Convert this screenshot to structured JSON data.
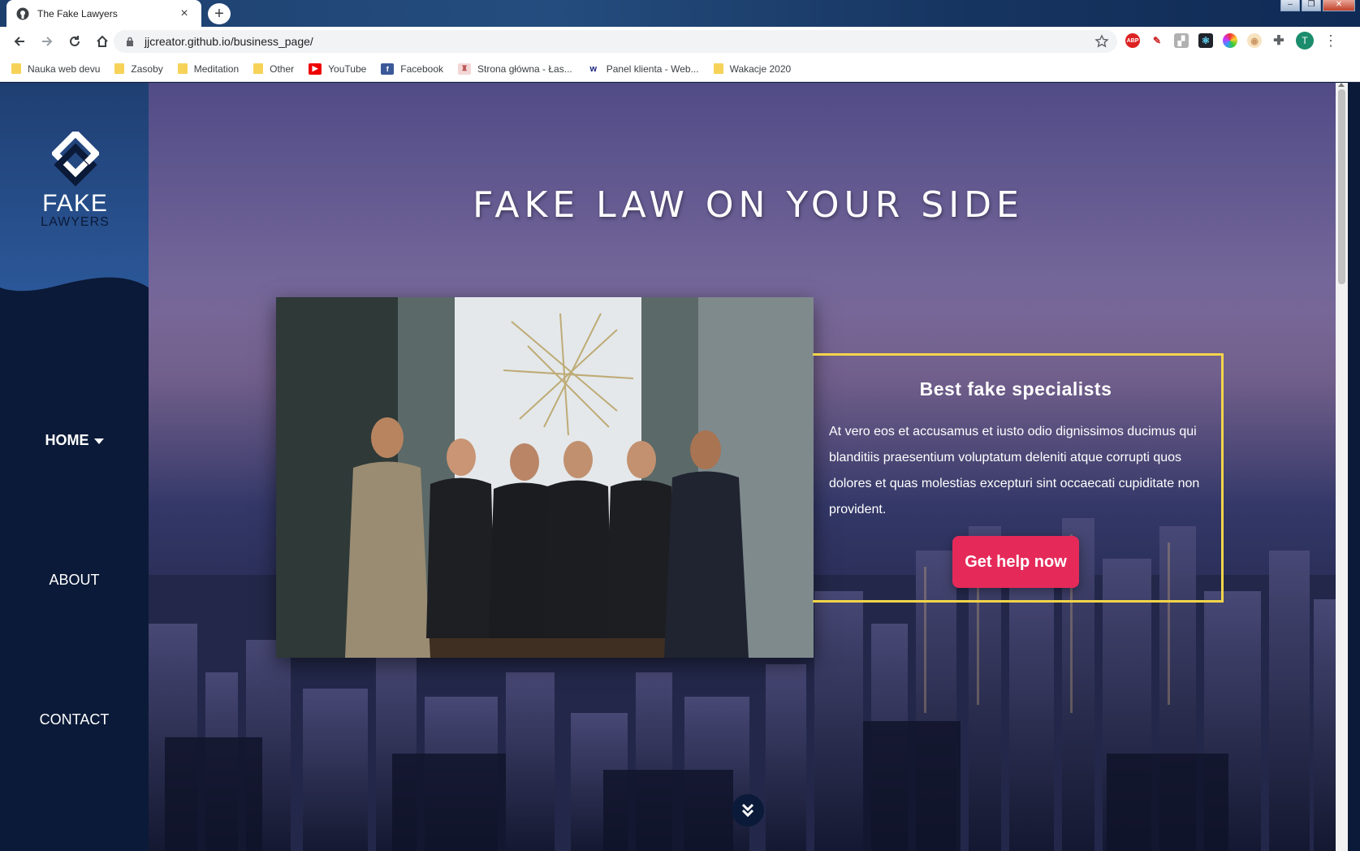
{
  "browser": {
    "tab_title": "The Fake Lawyers",
    "url": "jjcreator.github.io/business_page/",
    "profile_initial": "T",
    "extensions": [
      "ABP",
      "adobe-icon",
      "pdf-icon",
      "react-devtools-icon",
      "colorpicker-icon",
      "onion-icon",
      "puzzle-icon"
    ]
  },
  "bookmarks": [
    {
      "label": "Nauka web devu",
      "icon": "folder-icon"
    },
    {
      "label": "Zasoby",
      "icon": "folder-icon"
    },
    {
      "label": "Meditation",
      "icon": "folder-icon"
    },
    {
      "label": "Other",
      "icon": "folder-icon"
    },
    {
      "label": "YouTube",
      "icon": "youtube-icon"
    },
    {
      "label": "Facebook",
      "icon": "facebook-icon"
    },
    {
      "label": "Strona główna - Łas...",
      "icon": "castle-icon"
    },
    {
      "label": "Panel klienta - Web...",
      "icon": "webhost-icon"
    },
    {
      "label": "Wakacje 2020",
      "icon": "folder-icon"
    }
  ],
  "sidebar": {
    "brand_line1": "FAKE",
    "brand_line2": "LAWYERS",
    "nav": [
      {
        "label": "HOME",
        "active": true
      },
      {
        "label": "ABOUT",
        "active": false
      },
      {
        "label": "CONTACT",
        "active": false
      }
    ]
  },
  "hero": {
    "title": "FAKE LAW ON YOUR SIDE",
    "info_title": "Best fake specialists",
    "info_text": "At vero eos et accusamus et iusto odio dignissimos ducimus qui blanditiis praesentium voluptatum deleniti atque corrupti quos dolores et quas molestias excepturi sint occaecati cupiditate non provident.",
    "cta_label": "Get help now"
  },
  "colors": {
    "sidebar": "#0b1a38",
    "accent_border": "#f4d54a",
    "cta": "#e52a5a"
  }
}
